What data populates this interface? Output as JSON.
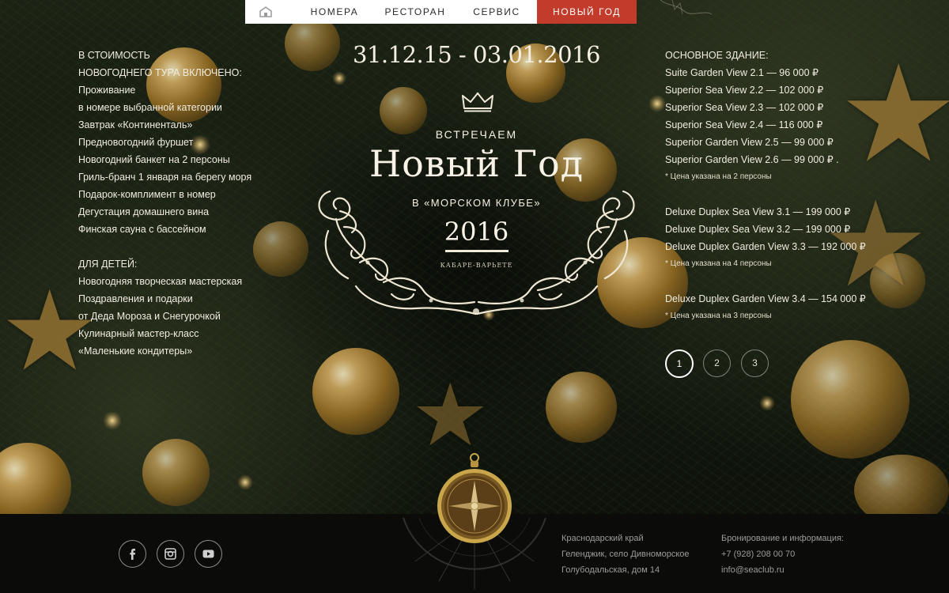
{
  "nav": {
    "home_icon": "home-icon",
    "items": [
      {
        "label": "НОМЕРА"
      },
      {
        "label": "РЕСТОРАН"
      },
      {
        "label": "СЕРВИС"
      },
      {
        "label": "НОВЫЙ ГОД",
        "active": true
      }
    ],
    "active_color": "#c23b2b"
  },
  "left": {
    "included_heading_1": "В СТОИМОСТЬ",
    "included_heading_2": "НОВОГОДНЕГО ТУРА ВКЛЮЧЕНО:",
    "included": [
      "Проживание",
      "в номере выбранной категории",
      "Завтрак «Континенталь»",
      "Предновогодний фуршет",
      "Новогодний банкет на 2 персоны",
      "Гриль-бранч 1 января на берегу моря",
      "Подарок-комплимент в номер",
      "Дегустация домашнего вина",
      "Финская сауна с бассейном"
    ],
    "kids_heading": "ДЛЯ ДЕТЕЙ:",
    "kids": [
      "Новогодняя творческая мастерская",
      "Поздравления  и подарки",
      "от Деда Мороза и Снегурочкой",
      "Кулинарный мастер-класс",
      "«Маленькие кондитеры»"
    ]
  },
  "center": {
    "dates": "31.12.15 - 03.01.2016",
    "crown_icon": "crown-icon",
    "meet": "ВСТРЕЧАЕМ",
    "title": "Новый Год",
    "club": "В «МОРСКОМ КЛУБЕ»",
    "year": "2016",
    "cabaret": "КАБАРЕ-ВАРЬЕТЕ"
  },
  "right": {
    "heading": "ОСНОВНОЕ ЗДАНИЕ:",
    "group1": [
      "Suite Garden View 2.1 — 96 000 ₽",
      "Superior Sea View 2.2 — 102 000 ₽",
      "Superior Sea View 2.3 — 102 000 ₽",
      "Superior Sea View 2.4 — 116 000 ₽",
      "Superior Garden View 2.5 — 99 000 ₽",
      "Superior Garden View 2.6 — 99 000 ₽ ."
    ],
    "note1": "* Цена указана на 2 персоны",
    "group2": [
      "Deluxe Duplex Sea View 3.1 — 199 000 ₽",
      "Deluxe Duplex Sea View 3.2 — 199 000 ₽",
      "Deluxe Duplex Garden View 3.3 — 192 000 ₽"
    ],
    "note2": "* Цена указана на 4 персоны",
    "group3": [
      "Deluxe Duplex Garden View  3.4 — 154 000 ₽"
    ],
    "note3": "* Цена указана на 3 персоны"
  },
  "pager": {
    "pages": [
      "1",
      "2",
      "3"
    ],
    "active": "1"
  },
  "footer": {
    "social_icons": [
      "facebook-icon",
      "instagram-icon",
      "youtube-icon"
    ],
    "address": [
      "Краснодарский край",
      "Геленджик, село Дивноморское",
      "Голубодальская, дом 14"
    ],
    "contacts_heading": "Бронирование и информация:",
    "phone": "+7 (928) 208 00 70",
    "email": "info@seaclub.ru"
  }
}
